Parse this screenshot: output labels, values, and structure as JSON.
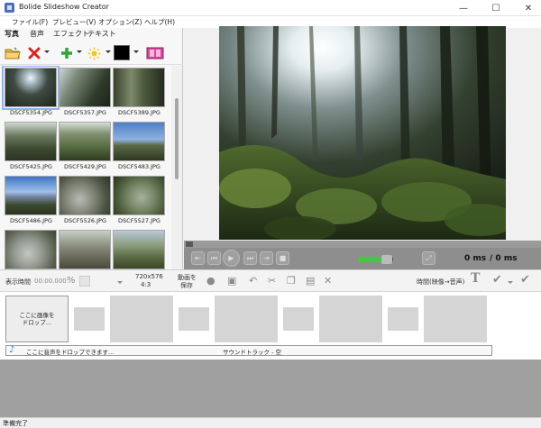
{
  "window": {
    "title": "Bolide Slideshow Creator",
    "minimize": "—",
    "maximize": "☐",
    "close": "✕"
  },
  "menu": [
    "ファイル(F)",
    "プレビュー(V)",
    "オプション(Z)",
    "ヘルプ(H)"
  ],
  "tabs": [
    "写真",
    "音声",
    "エフェクト",
    "テキスト"
  ],
  "active_tab": "写真",
  "toolbar_icons": [
    "open-folder-icon",
    "delete-icon",
    "add-icon",
    "effects-icon",
    "color-swatch",
    "filmstrip-icon"
  ],
  "photos": [
    {
      "name": "DSCF5354.JPG",
      "selected": true
    },
    {
      "name": "DSCF5357.JPG"
    },
    {
      "name": "DSCF5389.JPG"
    },
    {
      "name": "DSCF5425.JPG"
    },
    {
      "name": "DSCF5429.JPG"
    },
    {
      "name": "DSCF5483.JPG"
    },
    {
      "name": "DSCF5486.JPG"
    },
    {
      "name": "DSCF5526.JPG"
    },
    {
      "name": "DSCF5527.JPG"
    },
    {
      "name": ""
    },
    {
      "name": ""
    },
    {
      "name": ""
    }
  ],
  "player": {
    "time": "0 ms",
    "total": "/ 0 ms",
    "volume_fraction": 0.7,
    "seek_fraction": 0
  },
  "timeline_toolbar": {
    "duration_label": "表示時間",
    "duration_value": "00:00.000",
    "resolution": "720x576",
    "aspect": "4:3",
    "save_video_line1": "動画を",
    "save_video_line2": "保存",
    "time_mode": "時間(映像→音声)"
  },
  "timeline": {
    "drop_images": "ここに画像を\nドロップ…",
    "drop_audio": "ここに音声をドロップできます…",
    "soundtrack": "サウンドトラック - 空"
  },
  "status": "準備完了",
  "colors": {
    "accent": "#3a78c8",
    "volume": "#3fca3f",
    "controls": "#8e8e8e"
  }
}
